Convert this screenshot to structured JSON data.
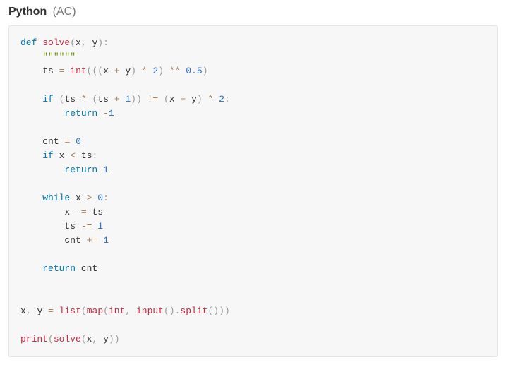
{
  "header": {
    "language": "Python",
    "status": "(AC)"
  },
  "code": {
    "tokens": {
      "def": "def",
      "solve": "solve",
      "x": "x",
      "y": "y",
      "docstring": "\"\"\"\"\"\"",
      "ts": "ts",
      "int": "int",
      "plus": "+",
      "times": "*",
      "two": "2",
      "dstar": "**",
      "half": "0.5",
      "if": "if",
      "one": "1",
      "neq": "!=",
      "return": "return",
      "neg1": "-1",
      "cnt": "cnt",
      "eq": "=",
      "zero": "0",
      "lt": "<",
      "while": "while",
      "gt": ">",
      "minuseq": "-=",
      "pluseq": "+=",
      "list": "list",
      "map": "map",
      "input": "input",
      "split": "split",
      "print": "print",
      "comma": ",",
      "colon": ":",
      "lpar": "(",
      "rpar": ")",
      "dot": "."
    }
  }
}
